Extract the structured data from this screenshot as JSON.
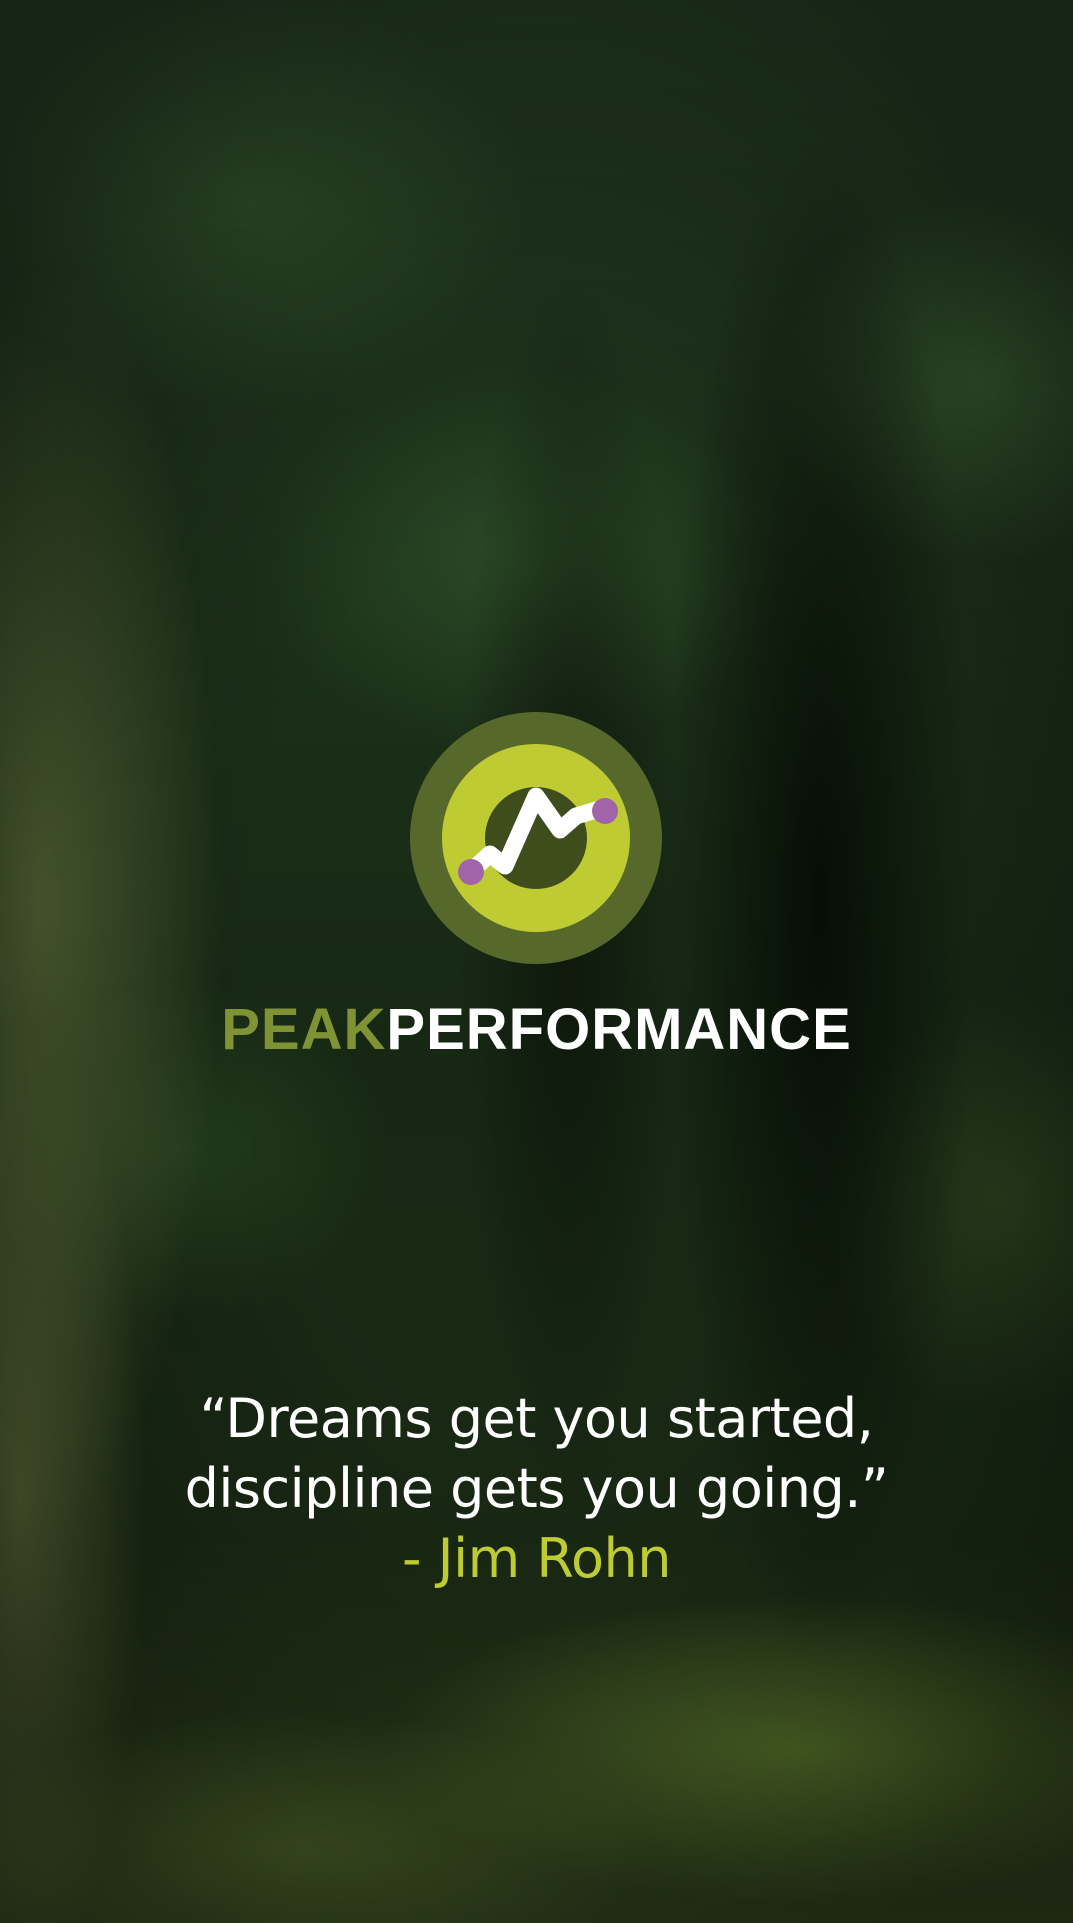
{
  "app": {
    "brand_primary": "PEAK",
    "brand_secondary": "PERFORMANCE",
    "logo_icon": "performance-chart-logo-icon"
  },
  "colors": {
    "brand_dark_green": "#7f9234",
    "logo_outer_ring": "#56682a",
    "logo_inner_ring": "#bfcb33",
    "logo_center": "#3f4d1c",
    "logo_dot": "#a264a8",
    "author_accent": "#bfcb33",
    "text": "#ffffff"
  },
  "quote": {
    "line1": "“Dreams get you started,",
    "line2": "discipline gets you going.”",
    "author": "- Jim Rohn"
  }
}
